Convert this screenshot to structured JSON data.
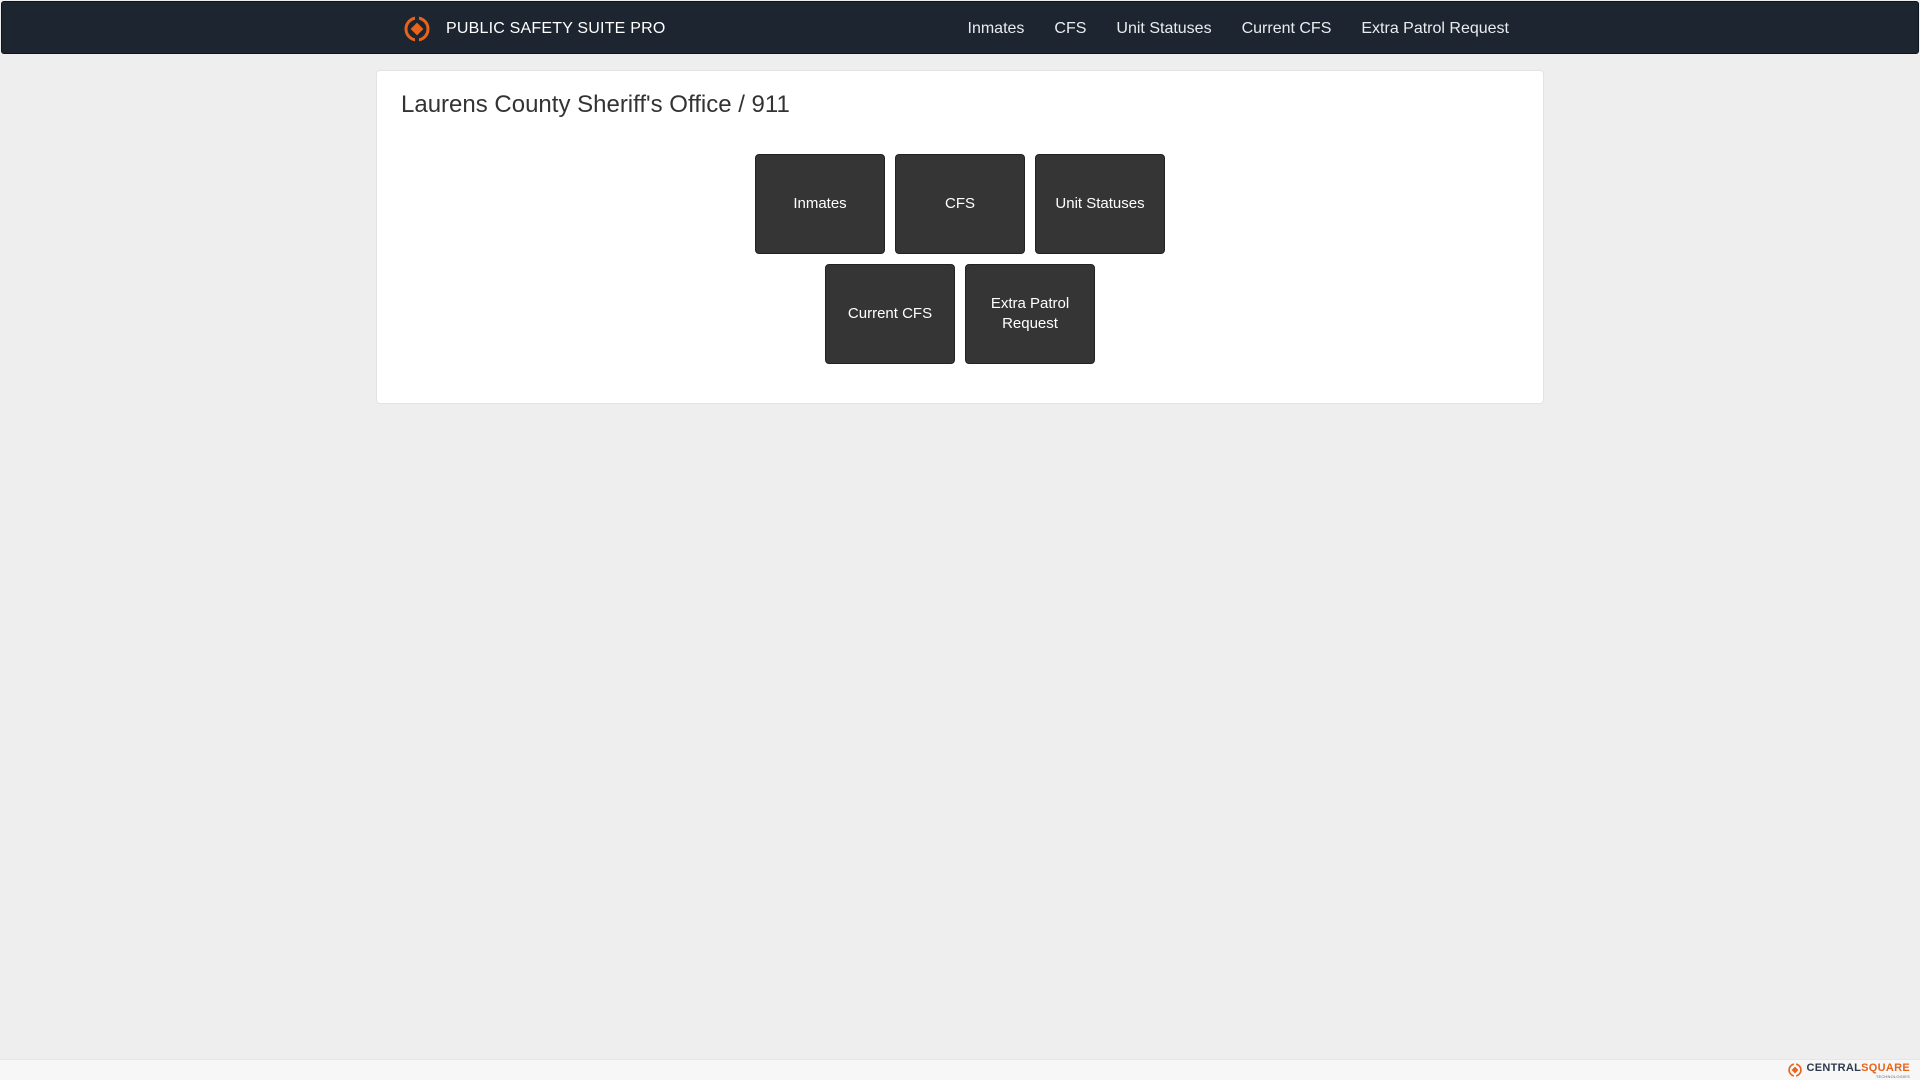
{
  "colors": {
    "navbar_bg": "#1d2530",
    "brand_accent": "#e8641b",
    "tile_bg": "#353535",
    "page_bg": "#eeeeee"
  },
  "navbar": {
    "brand_logo_icon": "centralsquare-logo-icon",
    "brand_text": "PUBLIC SAFETY SUITE PRO",
    "links": [
      "Inmates",
      "CFS",
      "Unit Statuses",
      "Current CFS",
      "Extra Patrol Request"
    ]
  },
  "main": {
    "title": "Laurens County Sheriff's Office / 911",
    "tiles": [
      "Inmates",
      "CFS",
      "Unit Statuses",
      "Current CFS",
      "Extra Patrol Request"
    ]
  },
  "footer": {
    "logo_icon": "centralsquare-logo-icon",
    "brand_part1": "CENTRAL",
    "brand_part2": "SQUARE",
    "brand_sub": "TECHNOLOGIES"
  }
}
